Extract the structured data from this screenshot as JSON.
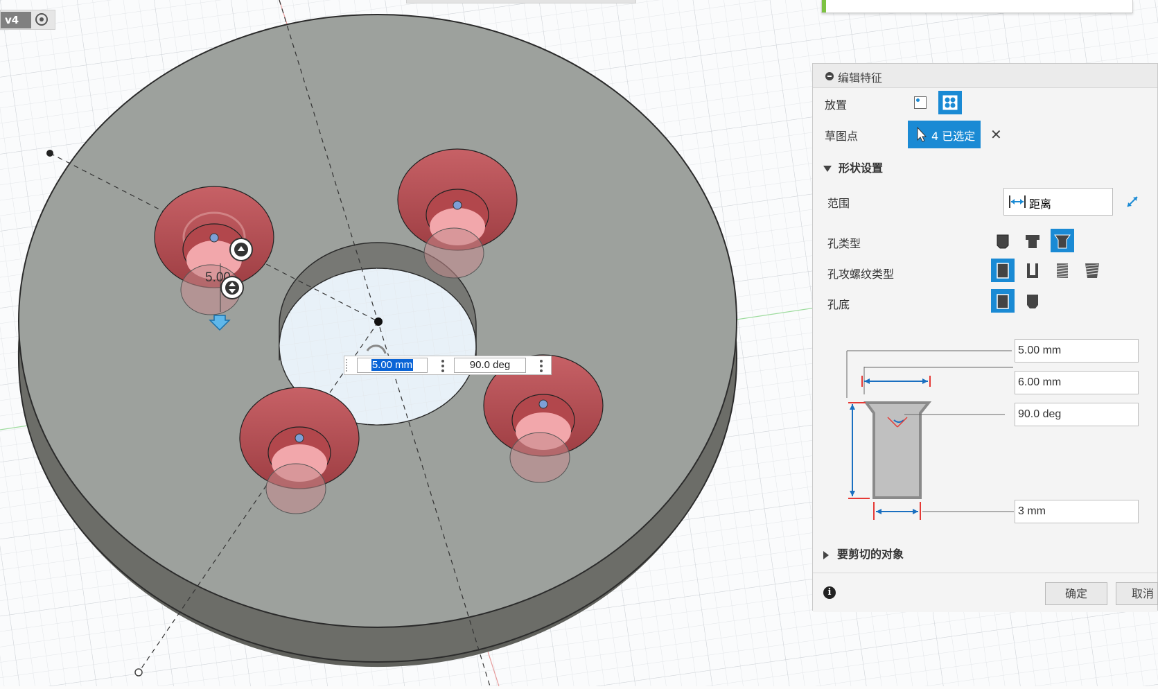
{
  "version": {
    "label": "v4"
  },
  "dimension_inputs": {
    "depth": "5.00 mm",
    "angle": "90.0 deg"
  },
  "viewport_labels": {
    "depth_label": "5.00"
  },
  "panel": {
    "title": "编辑特征",
    "placement_label": "放置",
    "sketch_points_label": "草图点",
    "selected_text": "4 已选定",
    "shape_section": "形状设置",
    "extent_label": "范围",
    "extent_value": "距离",
    "hole_type_label": "孔类型",
    "hole_tap_type_label": "孔攻螺纹类型",
    "hole_bottom_label": "孔底",
    "fields": {
      "depth": "5.00 mm",
      "countersink_diameter": "6.00 mm",
      "countersink_angle": "90.0 deg",
      "diameter": "3 mm"
    },
    "objects_to_cut": "要剪切的对象",
    "ok": "确定",
    "cancel": "取消"
  },
  "colors": {
    "accent": "#1a8ad4",
    "hole_red": "#b8484d",
    "body_grey": "#9ca09c"
  }
}
